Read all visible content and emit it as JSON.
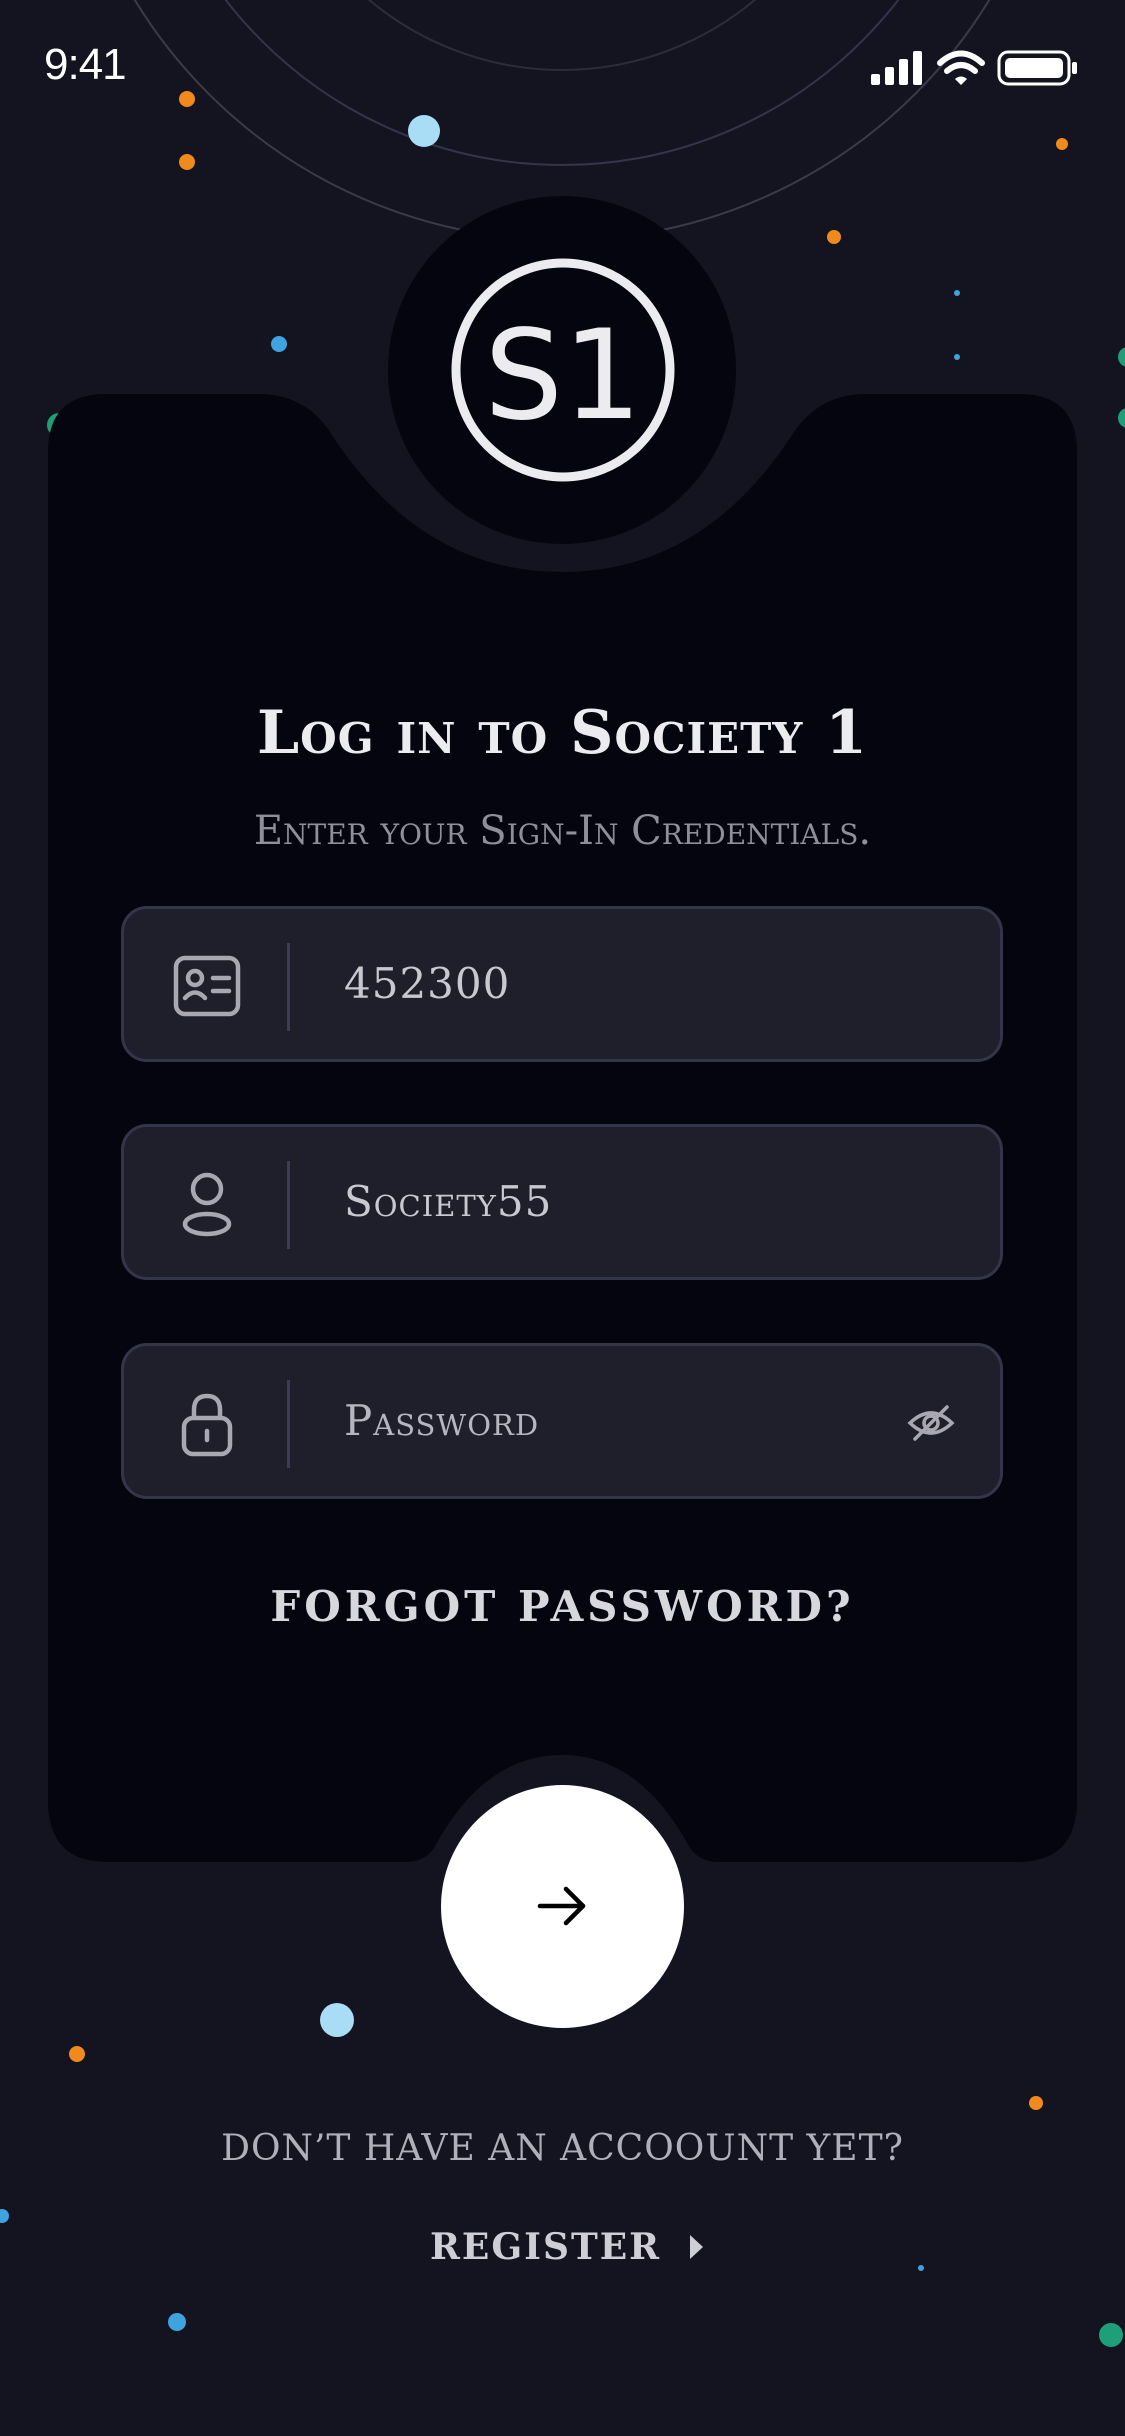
{
  "status_bar": {
    "time": "9:41"
  },
  "logo": {
    "text": "S1"
  },
  "login": {
    "title": "Log in to Society 1",
    "subtitle": "Enter your Sign-In Credentials."
  },
  "fields": {
    "id_value": "452300",
    "username_value": "Society55",
    "password_placeholder": "Password"
  },
  "actions": {
    "forgot_password": "FORGOT PASSWORD?",
    "no_account": "DON’T HAVE AN ACCOOUNT YET?",
    "register": "REGISTER"
  },
  "icons": {
    "id": "id-card-icon",
    "user": "user-icon",
    "lock": "lock-icon",
    "visibility": "eye-off-icon",
    "submit": "arrow-right-icon",
    "register": "caret-right-icon"
  },
  "colors": {
    "background": "#141420",
    "card": "#05050f",
    "field": "#1f1f2b",
    "accent_orange": "#f08a1c",
    "accent_blue": "#3fa3e0",
    "accent_light_blue": "#a9dcf5",
    "accent_green": "#1f9e7a"
  }
}
